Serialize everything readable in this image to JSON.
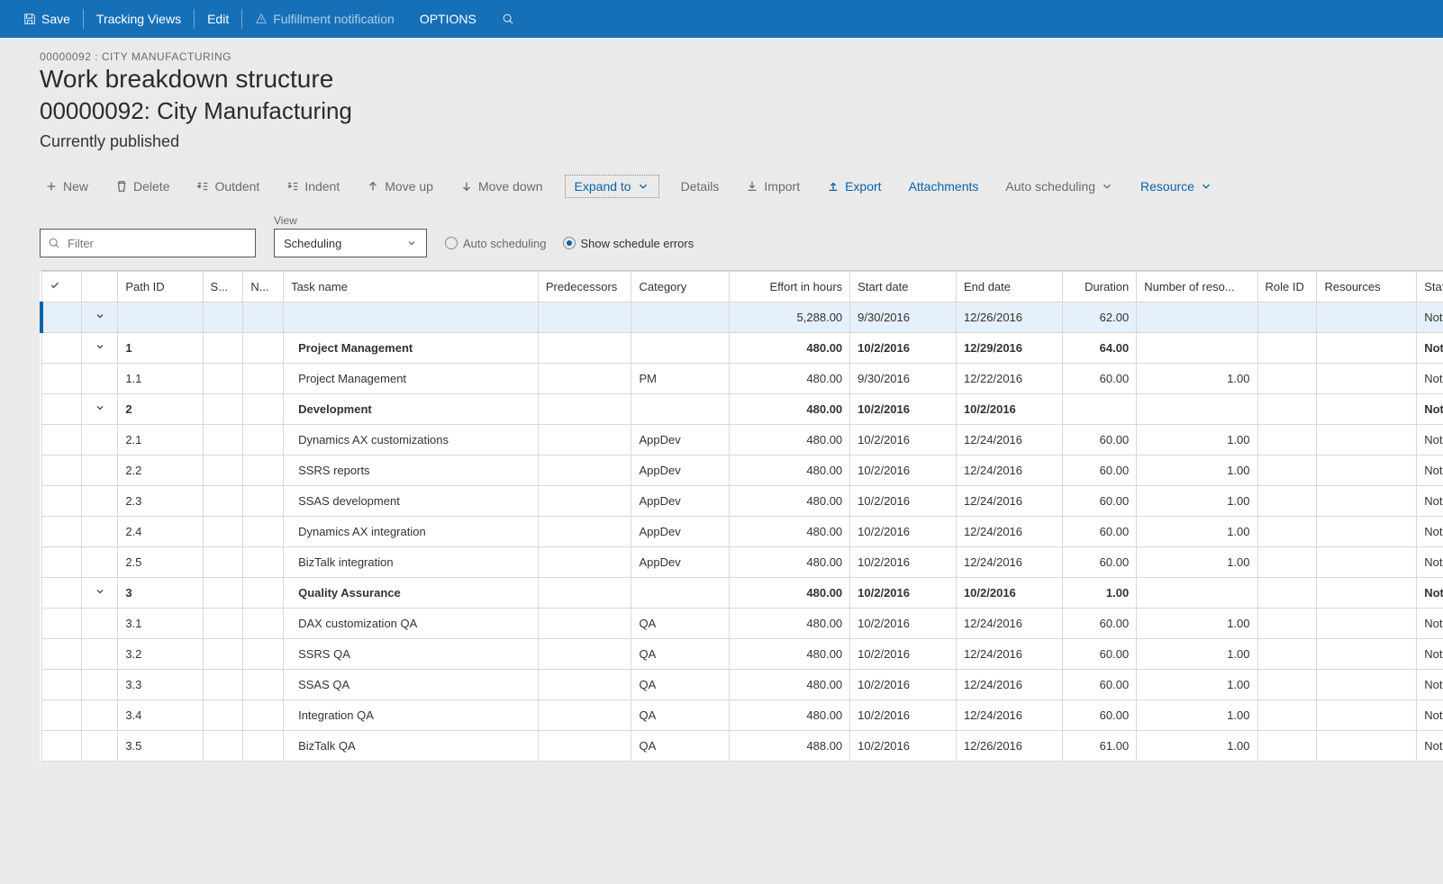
{
  "topbar": {
    "save": "Save",
    "tracking_views": "Tracking Views",
    "edit": "Edit",
    "fulfillment": "Fulfillment notification",
    "options": "OPTIONS"
  },
  "header": {
    "breadcrumb": "00000092 : CITY MANUFACTURING",
    "title": "Work breakdown structure",
    "subtitle": "00000092: City Manufacturing",
    "status": "Currently published"
  },
  "toolbar": {
    "new": "New",
    "delete": "Delete",
    "outdent": "Outdent",
    "indent": "Indent",
    "moveup": "Move up",
    "movedown": "Move down",
    "expand_to": "Expand to",
    "details": "Details",
    "import": "Import",
    "export": "Export",
    "attachments": "Attachments",
    "auto_sched": "Auto scheduling",
    "resource": "Resource"
  },
  "controls": {
    "filter_placeholder": "Filter",
    "view_label": "View",
    "view_value": "Scheduling",
    "radio_auto": "Auto scheduling",
    "radio_errors": "Show schedule errors"
  },
  "columns": {
    "check": "✓",
    "path": "Path ID",
    "s": "S...",
    "n": "N...",
    "task": "Task name",
    "pred": "Predecessors",
    "cat": "Category",
    "effort": "Effort in hours",
    "start": "Start date",
    "end": "End date",
    "dur": "Duration",
    "numres": "Number of reso...",
    "role": "Role ID",
    "res": "Resources",
    "staff": "Staffing s"
  },
  "rows": [
    {
      "sel": true,
      "exp": true,
      "bold": false,
      "path": "",
      "task": "",
      "cat": "",
      "effort": "5,288.00",
      "start": "9/30/2016",
      "end": "12/26/2016",
      "dur": "62.00",
      "numres": "",
      "staff": "Not sta"
    },
    {
      "exp": true,
      "bold": true,
      "path": "1",
      "task": "Project Management",
      "cat": "",
      "effort": "480.00",
      "start": "10/2/2016",
      "end": "12/29/2016",
      "dur": "64.00",
      "numres": "",
      "staff": "Not sta"
    },
    {
      "path": "1.1",
      "task": "Project Management",
      "cat": "PM",
      "effort": "480.00",
      "start": "9/30/2016",
      "end": "12/22/2016",
      "dur": "60.00",
      "numres": "1.00",
      "staff": "Not sta"
    },
    {
      "exp": true,
      "bold": true,
      "path": "2",
      "task": "Development",
      "cat": "",
      "effort": "480.00",
      "start": "10/2/2016",
      "end": "10/2/2016",
      "dur": "",
      "numres": "",
      "staff": "Not sta"
    },
    {
      "path": "2.1",
      "task": "Dynamics AX customizations",
      "cat": "AppDev",
      "effort": "480.00",
      "start": "10/2/2016",
      "end": "12/24/2016",
      "dur": "60.00",
      "numres": "1.00",
      "staff": "Not sta"
    },
    {
      "path": "2.2",
      "task": "SSRS reports",
      "cat": "AppDev",
      "effort": "480.00",
      "start": "10/2/2016",
      "end": "12/24/2016",
      "dur": "60.00",
      "numres": "1.00",
      "staff": "Not sta"
    },
    {
      "path": "2.3",
      "task": "SSAS development",
      "cat": "AppDev",
      "effort": "480.00",
      "start": "10/2/2016",
      "end": "12/24/2016",
      "dur": "60.00",
      "numres": "1.00",
      "staff": "Not sta"
    },
    {
      "path": "2.4",
      "task": "Dynamics AX integration",
      "cat": "AppDev",
      "effort": "480.00",
      "start": "10/2/2016",
      "end": "12/24/2016",
      "dur": "60.00",
      "numres": "1.00",
      "staff": "Not sta"
    },
    {
      "path": "2.5",
      "task": "BizTalk integration",
      "cat": "AppDev",
      "effort": "480.00",
      "start": "10/2/2016",
      "end": "12/24/2016",
      "dur": "60.00",
      "numres": "1.00",
      "staff": "Not sta"
    },
    {
      "exp": true,
      "bold": true,
      "path": "3",
      "task": "Quality Assurance",
      "cat": "",
      "effort": "480.00",
      "start": "10/2/2016",
      "end": "10/2/2016",
      "dur": "1.00",
      "numres": "",
      "staff": "Not sta"
    },
    {
      "path": "3.1",
      "task": "DAX customization QA",
      "cat": "QA",
      "effort": "480.00",
      "start": "10/2/2016",
      "end": "12/24/2016",
      "dur": "60.00",
      "numres": "1.00",
      "staff": "Not sta"
    },
    {
      "path": "3.2",
      "task": "SSRS QA",
      "cat": "QA",
      "effort": "480.00",
      "start": "10/2/2016",
      "end": "12/24/2016",
      "dur": "60.00",
      "numres": "1.00",
      "staff": "Not sta"
    },
    {
      "path": "3.3",
      "task": "SSAS QA",
      "cat": "QA",
      "effort": "480.00",
      "start": "10/2/2016",
      "end": "12/24/2016",
      "dur": "60.00",
      "numres": "1.00",
      "staff": "Not sta"
    },
    {
      "path": "3.4",
      "task": "Integration QA",
      "cat": "QA",
      "effort": "480.00",
      "start": "10/2/2016",
      "end": "12/24/2016",
      "dur": "60.00",
      "numres": "1.00",
      "staff": "Not sta"
    },
    {
      "path": "3.5",
      "task": "BizTalk QA",
      "cat": "QA",
      "effort": "488.00",
      "start": "10/2/2016",
      "end": "12/26/2016",
      "dur": "61.00",
      "numres": "1.00",
      "staff": "Not sta"
    }
  ]
}
